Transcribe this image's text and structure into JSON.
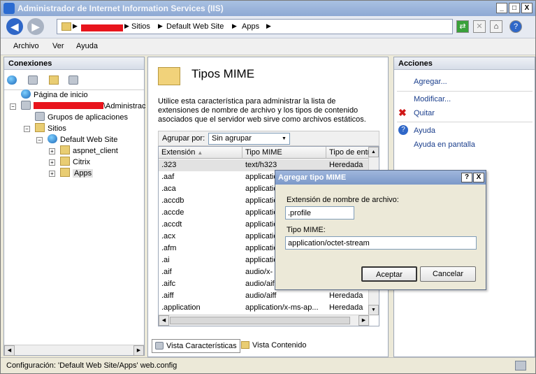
{
  "window": {
    "title": "Administrador de Internet Information Services (IIS)"
  },
  "titlebar_buttons": {
    "minimize": "_",
    "maximize": "□",
    "close": "X"
  },
  "address": {
    "crumbs": [
      "Sitios",
      "Default Web Site",
      "Apps"
    ]
  },
  "menu": {
    "items": [
      "Archivo",
      "Ver",
      "Ayuda"
    ]
  },
  "connections": {
    "header": "Conexiones",
    "tree": {
      "start_page": "Página de inicio",
      "server_suffix": "\\Administrac",
      "app_pools": "Grupos de aplicaciones",
      "sites": "Sitios",
      "default_site": "Default Web Site",
      "children": [
        "aspnet_client",
        "Citrix",
        "Apps"
      ]
    }
  },
  "features": {
    "title": "Tipos MIME",
    "description": "Utilice esta característica para administrar la lista de extensiones de nombre de archivo y los tipos de contenido asociados que el servidor web sirve como archivos estáticos.",
    "group_label": "Agrupar por:",
    "group_value": "Sin agrupar",
    "columns": [
      "Extensión",
      "Tipo MIME",
      "Tipo de entr"
    ],
    "rows": [
      {
        "ext": ".323",
        "mime": "text/h323",
        "type": "Heredada"
      },
      {
        "ext": ".aaf",
        "mime": "application",
        "type": ""
      },
      {
        "ext": ".aca",
        "mime": "application",
        "type": ""
      },
      {
        "ext": ".accdb",
        "mime": "application",
        "type": ""
      },
      {
        "ext": ".accde",
        "mime": "application",
        "type": ""
      },
      {
        "ext": ".accdt",
        "mime": "application",
        "type": ""
      },
      {
        "ext": ".acx",
        "mime": "application",
        "type": ""
      },
      {
        "ext": ".afm",
        "mime": "application",
        "type": ""
      },
      {
        "ext": ".ai",
        "mime": "application",
        "type": ""
      },
      {
        "ext": ".aif",
        "mime": "audio/x-",
        "type": ""
      },
      {
        "ext": ".aifc",
        "mime": "audio/aif",
        "type": ""
      },
      {
        "ext": ".aiff",
        "mime": "audio/aiff",
        "type": "Heredada"
      },
      {
        "ext": ".application",
        "mime": "application/x-ms-ap...",
        "type": "Heredada"
      }
    ]
  },
  "view_tabs": {
    "features": "Vista Características",
    "content": "Vista Contenido"
  },
  "actions": {
    "header": "Acciones",
    "add": "Agregar...",
    "edit": "Modificar...",
    "remove": "Quitar",
    "help": "Ayuda",
    "help_online": "Ayuda en pantalla"
  },
  "dialog": {
    "title": "Agregar tipo MIME",
    "help_btn": "?",
    "close_btn": "X",
    "ext_label": "Extensión de nombre de archivo:",
    "ext_value": ".profile",
    "mime_label": "Tipo MIME:",
    "mime_value": "application/octet-stream",
    "ok": "Aceptar",
    "cancel": "Cancelar"
  },
  "status": {
    "text": "Configuración: 'Default Web Site/Apps' web.config"
  },
  "colors": {
    "accent": "#7c99c9",
    "link": "#1a3e8c",
    "redaction": "#e8141c"
  }
}
